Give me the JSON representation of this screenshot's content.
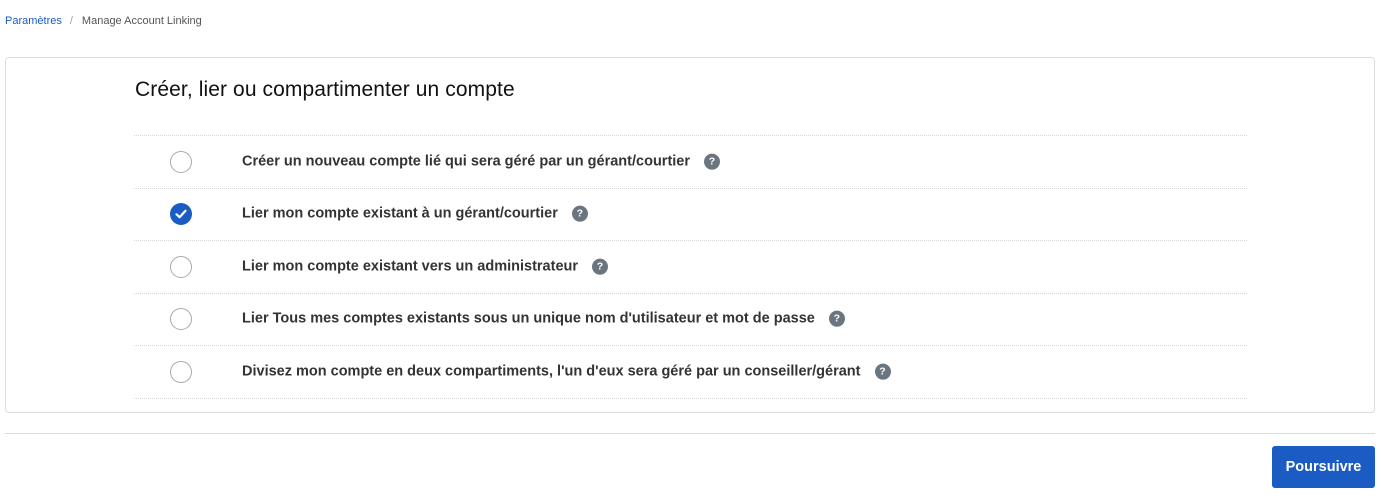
{
  "breadcrumb": {
    "parent": "Paramètres",
    "separator": "/",
    "current": "Manage Account Linking"
  },
  "card": {
    "title": "Créer, lier ou compartimenter un compte",
    "options": [
      {
        "label": "Créer un nouveau compte lié qui sera géré par un gérant/courtier",
        "selected": false,
        "help_icon": "question-circle-icon"
      },
      {
        "label": "Lier mon compte existant à un gérant/courtier",
        "selected": true,
        "help_icon": "question-circle-icon"
      },
      {
        "label": "Lier mon compte existant vers un administrateur",
        "selected": false,
        "help_icon": "question-circle-icon"
      },
      {
        "label": "Lier Tous mes comptes existants sous un unique nom d'utilisateur et mot de passe",
        "selected": false,
        "help_icon": "question-circle-icon"
      },
      {
        "label": "Divisez mon compte en deux compartiments, l'un d'eux sera géré par un conseiller/gérant",
        "selected": false,
        "help_icon": "question-circle-icon"
      }
    ]
  },
  "footer": {
    "continue_label": "Poursuivre"
  },
  "colors": {
    "accent": "#1a5cc4",
    "help_icon_bg": "#6a7580",
    "border": "#dcdcdc"
  },
  "help_icon_glyph": "?"
}
